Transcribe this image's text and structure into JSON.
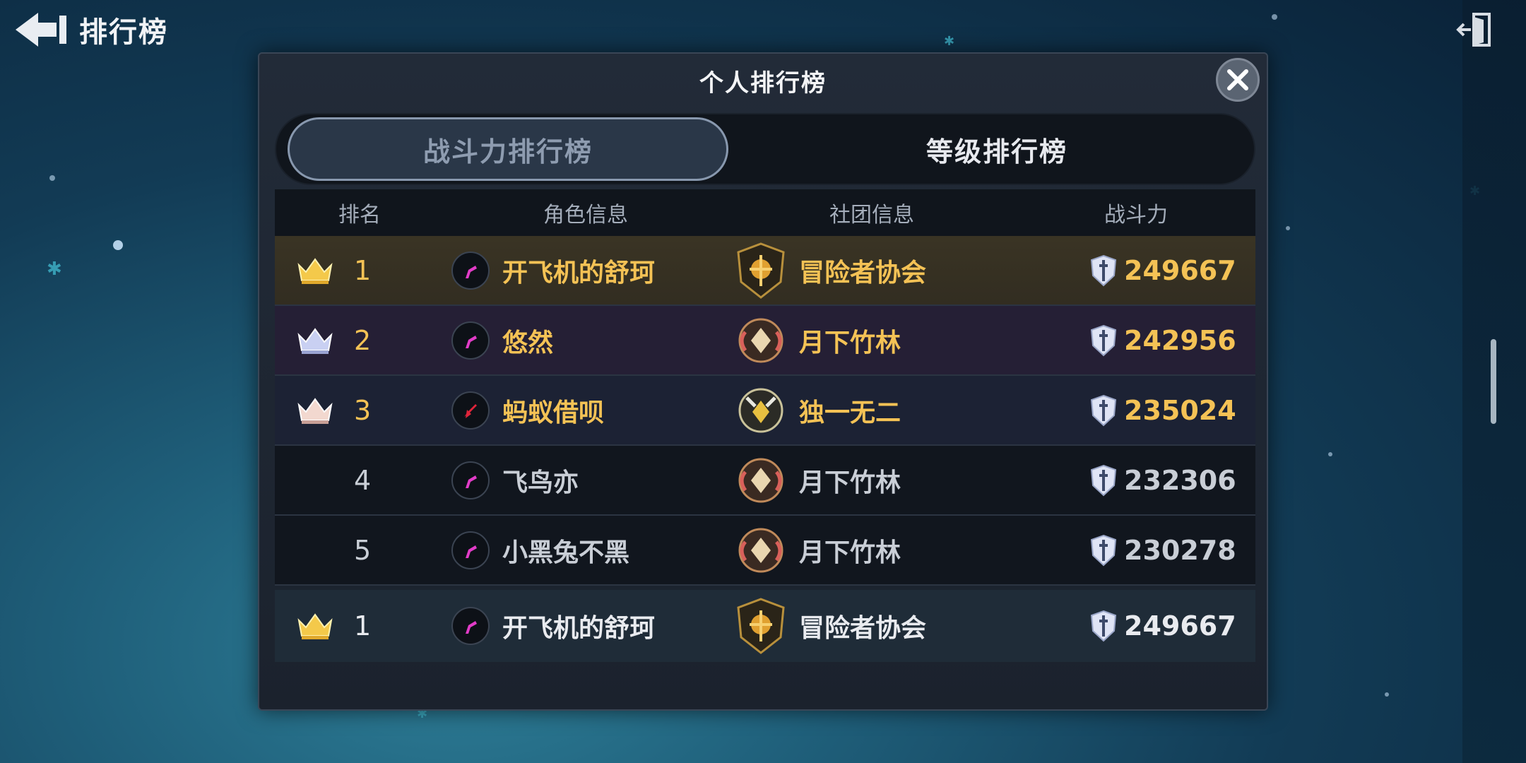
{
  "header": {
    "title": "排行榜"
  },
  "panel": {
    "title": "个人排行榜",
    "tabs": [
      {
        "label": "战斗力排行榜",
        "active": true
      },
      {
        "label": "等级排行榜",
        "active": false
      }
    ],
    "columns": {
      "rank": "排名",
      "role": "角色信息",
      "guild": "社团信息",
      "power": "战斗力"
    },
    "rows": [
      {
        "rank": "1",
        "name": "开飞机的舒珂",
        "guild": "冒险者协会",
        "power": "249667",
        "crown": "gold",
        "class_icon": "hook-icon"
      },
      {
        "rank": "2",
        "name": "悠然",
        "guild": "月下竹林",
        "power": "242956",
        "crown": "silver",
        "class_icon": "hook-icon"
      },
      {
        "rank": "3",
        "name": "蚂蚁借呗",
        "guild": "独一无二",
        "power": "235024",
        "crown": "bronze",
        "class_icon": "rocket-icon"
      },
      {
        "rank": "4",
        "name": "飞鸟亦",
        "guild": "月下竹林",
        "power": "232306",
        "crown": "",
        "class_icon": "hook-icon"
      },
      {
        "rank": "5",
        "name": "小黑兔不黑",
        "guild": "月下竹林",
        "power": "230278",
        "crown": "",
        "class_icon": "hook-icon"
      }
    ],
    "my_rank": {
      "rank": "1",
      "name": "开飞机的舒珂",
      "guild": "冒险者协会",
      "power": "249667",
      "crown": "gold",
      "class_icon": "hook-icon"
    }
  },
  "colors": {
    "gold_text": "#f4c255",
    "panel_bg": "#1b222d",
    "accent_tab_border": "#8898ae",
    "class_icon": "#e23cc8"
  }
}
